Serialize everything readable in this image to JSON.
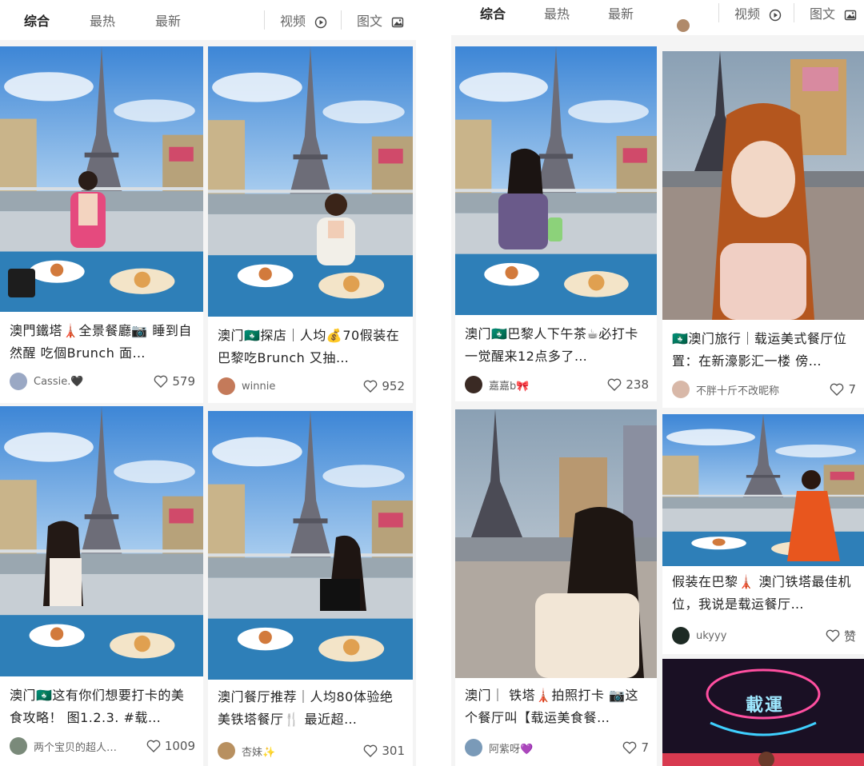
{
  "left": {
    "tabs": [
      "综合",
      "最热",
      "最新"
    ],
    "filters": {
      "video": "视频",
      "text": "图文"
    },
    "cards": [
      {
        "title": "澳門鐵塔🗼全景餐廳📷 睡到自然醒 吃個Brunch 面…",
        "author": "Cassie.🖤",
        "likes": "579"
      },
      {
        "title": "澳门🇲🇴探店｜人均💰70假装在巴黎吃Brunch 又抽…",
        "author": "winnie",
        "likes": "952"
      },
      {
        "title": "澳门🇲🇴这有你们想要打卡的美食攻略！ 图1.2.3. #载…",
        "author": "两个宝贝的超人…",
        "likes": "1009"
      },
      {
        "title": "澳门餐厅推荐｜人均80体验绝美铁塔餐厅🍴 最近超…",
        "author": "杏妹✨",
        "likes": "301"
      }
    ]
  },
  "right": {
    "tabs": [
      "综合",
      "最热",
      "最新"
    ],
    "filters": {
      "video": "视频",
      "text": "图文"
    },
    "cards": [
      {
        "title": "澳门🇲🇴巴黎人下午茶☕必打卡 一觉醒来12点多了…",
        "author": "嘉嘉b🎀",
        "likes": "238"
      },
      {
        "title": "🇲🇴澳门旅行｜载运美式餐厅位置：在新濠影汇一楼 傍…",
        "author": "不胖十斤不改昵称",
        "likes": "7"
      },
      {
        "title": "假装在巴黎🗼 澳门铁塔最佳机位，我说是载运餐厅…",
        "author": "ukyyy",
        "likes": "赞"
      },
      {
        "title": "澳门｜ 铁塔🗼拍照打卡 📷这个餐厅叫【载运美食餐…",
        "author": "阿紫呀💜",
        "likes": "7"
      }
    ],
    "neon_sign": "載運"
  },
  "colors": {
    "accent": "#ff2442",
    "text": "#222222",
    "muted": "#666666",
    "sky": "#5c9fe0",
    "table": "#2e7fb8"
  },
  "icons": {
    "video": "play-circle-icon",
    "text": "image-icon",
    "like": "heart-outline-icon"
  }
}
